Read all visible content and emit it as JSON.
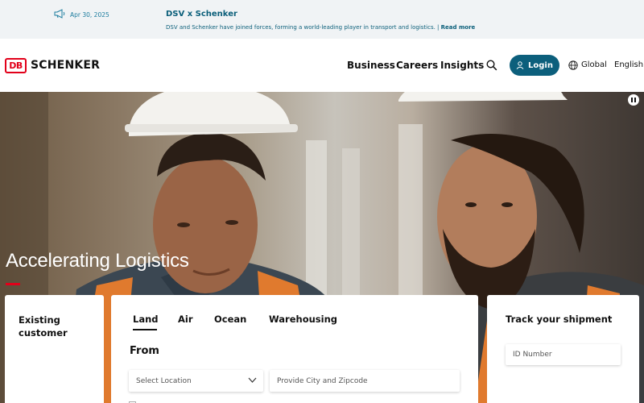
{
  "announcement": {
    "date": "Apr 30, 2025",
    "title": "DSV x Schenker",
    "description": "DSV and Schenker have joined forces, forming a world-leading player in transport and logistics. |",
    "read_more": "Read more"
  },
  "header": {
    "logo_mark": "DB",
    "brand": "SCHENKER",
    "nav": [
      "Business",
      "Careers",
      "Insights"
    ],
    "login_label": "Login",
    "region_label": "Global",
    "language": "English"
  },
  "hero": {
    "headline": "Accelerating Logistics"
  },
  "existing_customer": {
    "title": "Existing customer"
  },
  "quote": {
    "tabs": [
      "Land",
      "Air",
      "Ocean",
      "Warehousing"
    ],
    "active_tab": "Land",
    "from_label": "From",
    "select_placeholder": "Select Location",
    "city_placeholder": "Provide City and Zipcode"
  },
  "track": {
    "title": "Track your shipment",
    "id_placeholder": "ID Number"
  },
  "colors": {
    "brand_red": "#e2001a",
    "primary_teal": "#0c5f7c",
    "announcement_bg": "#f0f3f5"
  }
}
